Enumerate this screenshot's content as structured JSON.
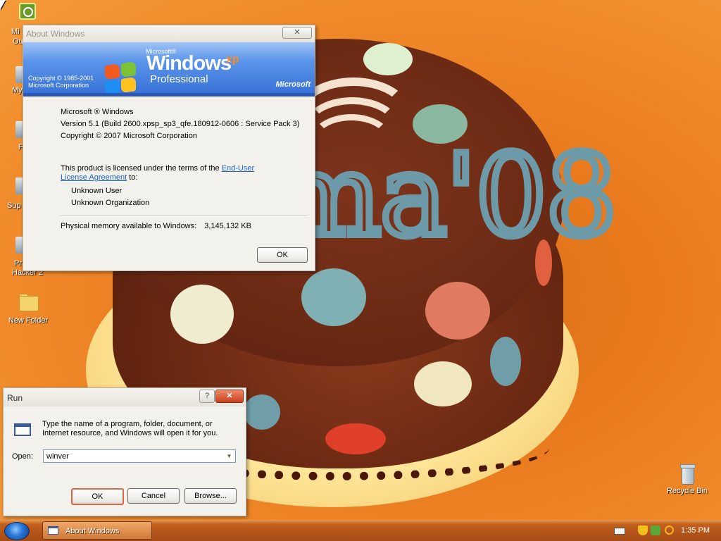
{
  "desktop": {
    "icons": [
      {
        "label": "New Folder"
      },
      {
        "label": "Recycle Bin"
      }
    ],
    "partial_labels": [
      "Mi",
      "Ou",
      "My",
      "F",
      "Sup",
      "Pr",
      "Hacker 2"
    ]
  },
  "about_window": {
    "title": "About Windows",
    "close_label": "✕",
    "banner": {
      "copyright_line1": "Copyright © 1985-2001",
      "copyright_line2": "Microsoft Corporation",
      "ms_small": "Microsoft®",
      "windows_word": "Windows",
      "xp": "xp",
      "edition": "Professional",
      "ms_logo": "Microsoft"
    },
    "product": "Microsoft ® Windows",
    "version": "Version 5.1 (Build 2600.xpsp_sp3_qfe.180912-0606 : Service Pack 3)",
    "copyright": "Copyright © 2007 Microsoft Corporation",
    "license_prefix": "This product is licensed under the terms of the",
    "license_link_1": "End-User",
    "license_link_2": "License Agreement",
    "license_suffix": " to:",
    "user": "Unknown User",
    "organization": "Unknown Organization",
    "memory_label": "Physical memory available to Windows:",
    "memory_value": "3,145,132 KB",
    "ok_label": "OK"
  },
  "run_window": {
    "title": "Run",
    "help_label": "?",
    "close_label": "✕",
    "description": "Type the name of a program, folder, document, or Internet resource, and Windows will open it for you.",
    "open_label": "Open:",
    "open_value": "winver",
    "ok_label": "OK",
    "cancel_label": "Cancel",
    "browse_label": "Browse..."
  },
  "taskbar": {
    "tasks": [
      {
        "label": "About Windows"
      }
    ],
    "clock": "1:35 PM"
  },
  "colors": {
    "desktop_orange": "#e8791c",
    "title_active_run": "#c8401c",
    "xp_blue": "#356fd6",
    "link": "#1a64c8"
  }
}
